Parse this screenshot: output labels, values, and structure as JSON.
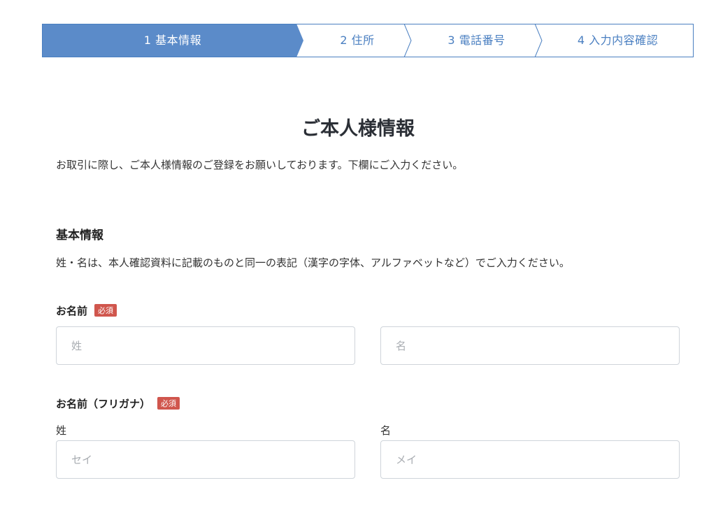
{
  "stepper": {
    "steps": [
      {
        "label": "1 基本情報",
        "state": "active"
      },
      {
        "label": "2 住所",
        "state": "inactive"
      },
      {
        "label": "3 電話番号",
        "state": "inactive"
      },
      {
        "label": "4 入力内容確認",
        "state": "inactive"
      }
    ],
    "active_color": "#5b8bc9",
    "border_color": "#4a7fc1"
  },
  "page": {
    "title": "ご本人様情報",
    "intro": "お取引に際し、ご本人様情報のご登録をお願いしております。下欄にご入力ください。"
  },
  "section": {
    "title": "基本情報",
    "note": "姓・名は、本人確認資料に記載のものと同一の表記（漢字の字体、アルファベットなど）でご入力ください。"
  },
  "fields": {
    "name": {
      "label": "お名前",
      "required_badge": "必須",
      "last_placeholder": "姓",
      "first_placeholder": "名",
      "last_value": "",
      "first_value": ""
    },
    "kana": {
      "label": "お名前（フリガナ）",
      "required_badge": "必須",
      "last_sublabel": "姓",
      "first_sublabel": "名",
      "last_placeholder": "セイ",
      "first_placeholder": "メイ",
      "last_value": "",
      "first_value": ""
    }
  }
}
